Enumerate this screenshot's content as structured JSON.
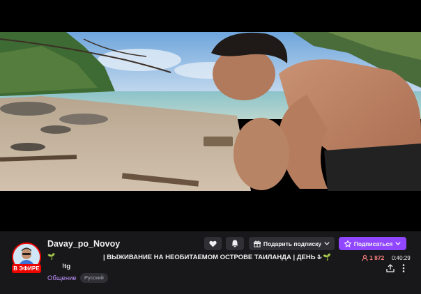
{
  "channel": {
    "name": "Davay_po_Novoy",
    "live_badge": "В ЭФИРЕ",
    "title": "| ВЫЖИВАНИЕ НА НЕОБИТАЕМОМ ОСТРОВЕ ТАИЛАНДА | ДЕНЬ 1 🌱",
    "title_prefix_icon": "🌱",
    "title_arrow": "→",
    "title_cont": "!tg",
    "category": "Общение",
    "tag": "Русский"
  },
  "actions": {
    "gift_label": "Подарить подписку",
    "subscribe_label": "Подписаться"
  },
  "stats": {
    "viewers": "1 872",
    "uptime": "0:40:29"
  },
  "icons": [
    "heart-icon",
    "bell-icon",
    "gift-icon",
    "chevron-down-icon",
    "star-icon",
    "person-icon",
    "share-icon",
    "more-icon"
  ],
  "colors": {
    "accent": "#9147ff",
    "live": "#eb0400",
    "viewers": "#ff8280",
    "category": "#bf94ff"
  }
}
